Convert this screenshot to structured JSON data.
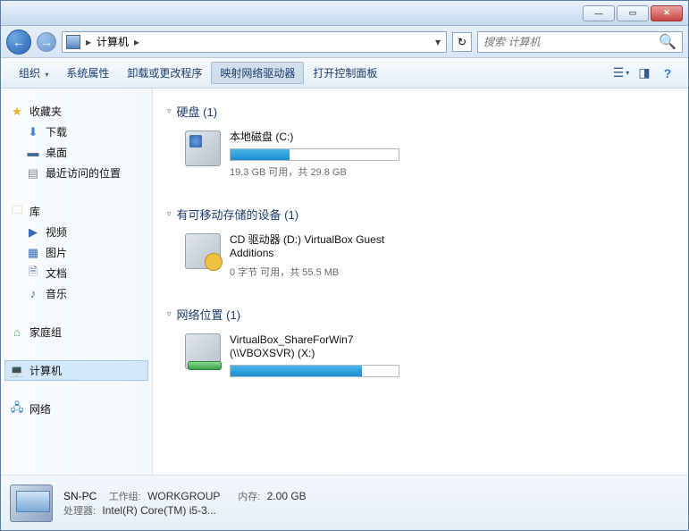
{
  "titlebar": {
    "min": "—",
    "max": "▭",
    "close": "✕"
  },
  "nav": {
    "back": "←",
    "fwd": "→",
    "refresh": "↻"
  },
  "address": {
    "computer": "计算机",
    "sep": "▸"
  },
  "search": {
    "placeholder": "搜索 计算机",
    "icon": "🔍"
  },
  "toolbar": {
    "org": "组织",
    "arrow": "▾",
    "sysprop": "系统属性",
    "uninstall": "卸载或更改程序",
    "mapnet": "映射网络驱动器",
    "ctrlpanel": "打开控制面板",
    "view": "☰",
    "preview": "◨",
    "help": "?"
  },
  "sidebar": {
    "fav": "收藏夹",
    "downloads": "下载",
    "desktop": "桌面",
    "recent": "最近访问的位置",
    "libraries": "库",
    "videos": "视频",
    "pictures": "图片",
    "documents": "文档",
    "music": "音乐",
    "homegroup": "家庭组",
    "computer": "计算机",
    "network": "网络"
  },
  "sections": {
    "hdd": "硬盘 (1)",
    "removable": "有可移动存储的设备 (1)",
    "netloc": "网络位置 (1)"
  },
  "drives": {
    "c": {
      "name": "本地磁盘 (C:)",
      "stat": "19.3 GB 可用，共 29.8 GB",
      "fill": "35%"
    },
    "d": {
      "name": "CD 驱动器 (D:) VirtualBox Guest Additions",
      "stat": "0 字节 可用，共 55.5 MB"
    },
    "x": {
      "name": "VirtualBox_ShareForWin7 (\\\\VBOXSVR) (X:)",
      "fill": "78%"
    }
  },
  "details": {
    "name": "SN-PC",
    "wg_label": "工作组:",
    "wg_val": "WORKGROUP",
    "mem_label": "内存:",
    "mem_val": "2.00 GB",
    "cpu_label": "处理器:",
    "cpu_val": "Intel(R) Core(TM) i5-3..."
  }
}
